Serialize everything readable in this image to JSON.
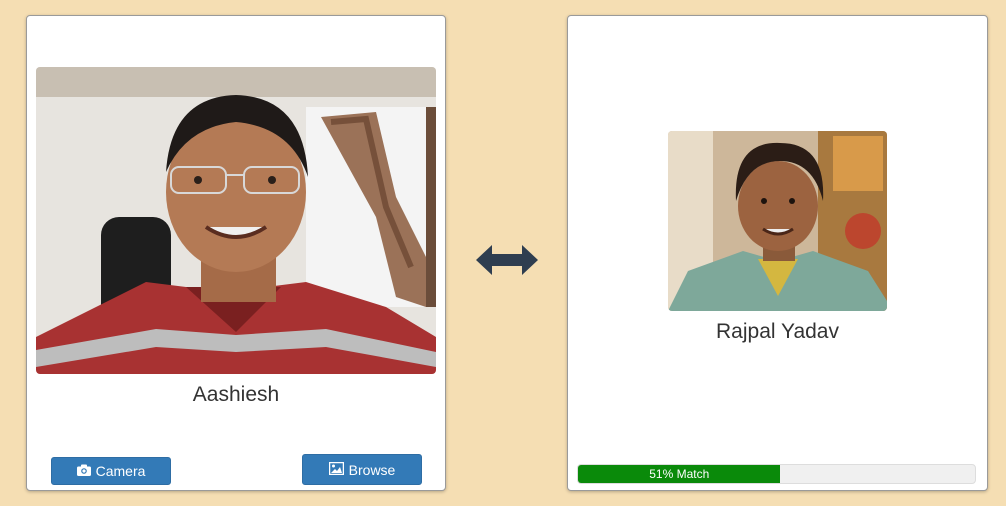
{
  "user": {
    "name": "Aashiesh",
    "photo_alt": "webcam-portrait-of-man-with-glasses"
  },
  "match": {
    "name": "Rajpal Yadav",
    "photo_alt": "portrait-of-man-in-green-jacket",
    "percent": 51,
    "label": "51% Match"
  },
  "buttons": {
    "camera_label": "Camera",
    "browse_label": "Browse"
  },
  "icons": {
    "camera": "camera-icon",
    "browse": "image-icon",
    "compare": "double-arrow-icon"
  },
  "colors": {
    "background": "#f5deb3",
    "button": "#337ab7",
    "progress": "#0a8a0a",
    "arrow": "#2f3e50"
  }
}
